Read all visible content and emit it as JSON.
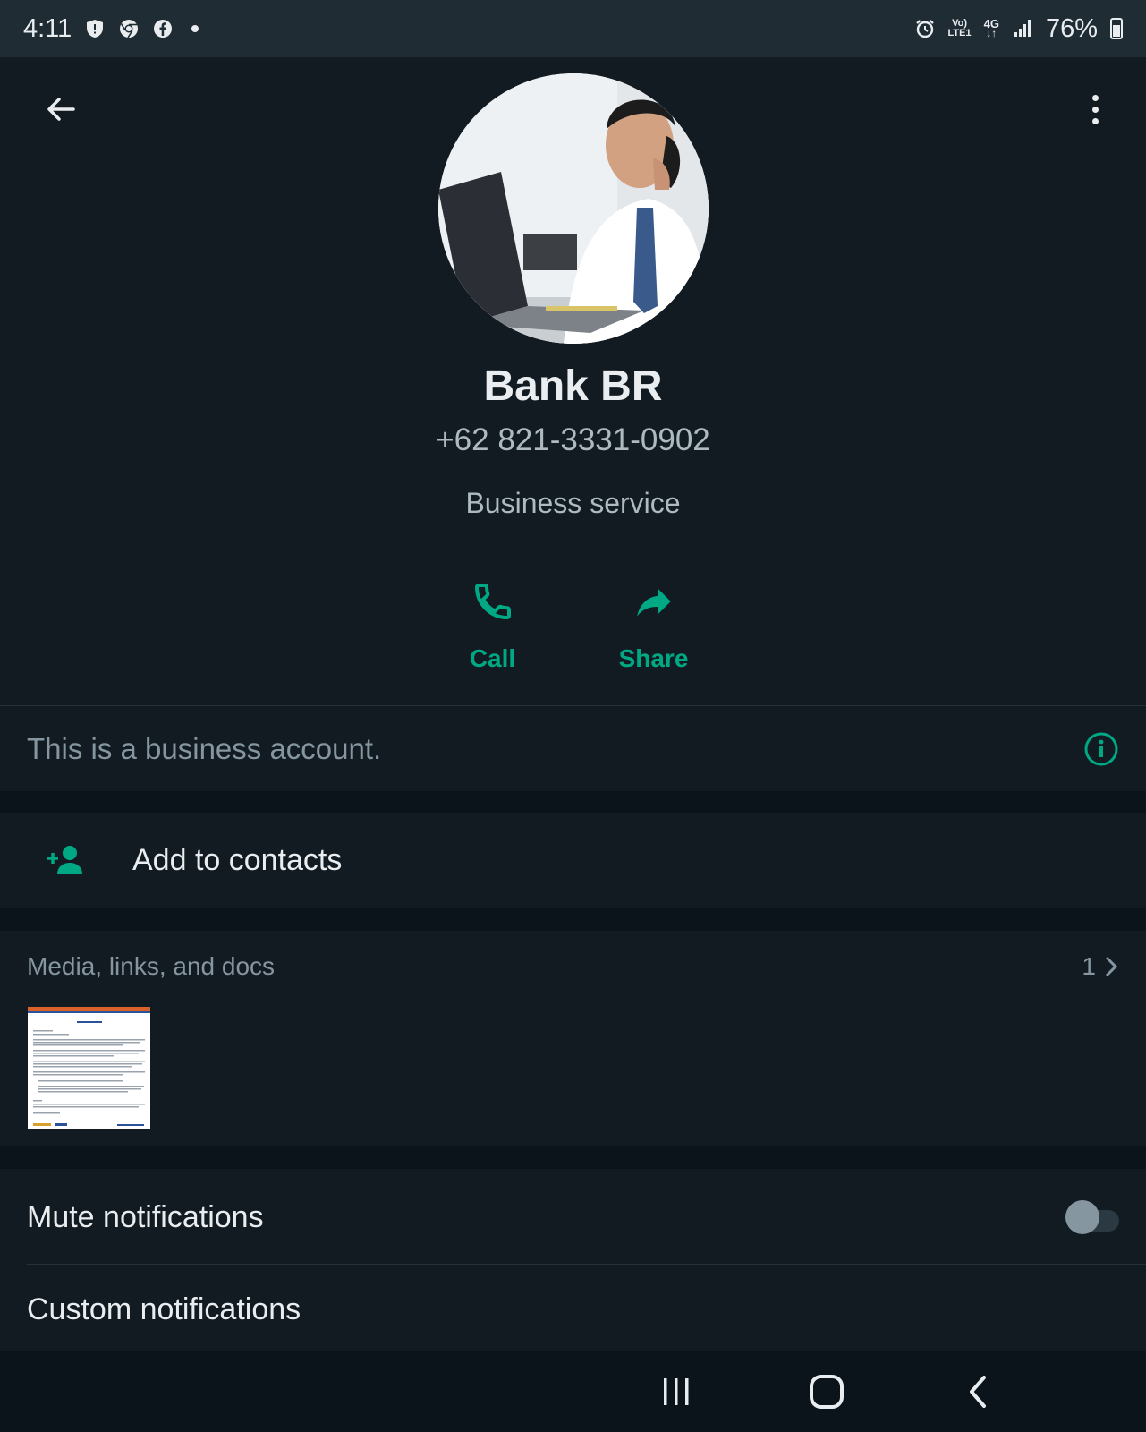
{
  "status_bar": {
    "time": "4:11",
    "battery": "76%",
    "net_top": "Vo)",
    "net_bottom": "LTE1",
    "net_gen": "4G",
    "icons": [
      "shield-icon",
      "chrome-icon",
      "facebook-icon",
      "notification-dot",
      "alarm-icon",
      "volte-icon",
      "4g-icon",
      "signal-icon",
      "battery-icon"
    ]
  },
  "header": {
    "back_icon": "arrow-left-icon",
    "menu_icon": "more-vert-icon"
  },
  "profile": {
    "name": "Bank BR",
    "phone": "+62 821-3331-0902",
    "category": "Business service"
  },
  "actions": [
    {
      "label": "Call",
      "icon": "phone-icon"
    },
    {
      "label": "Share",
      "icon": "share-icon"
    }
  ],
  "business_notice": {
    "text": "This is a business account.",
    "icon": "info-icon"
  },
  "add_contact": {
    "label": "Add to contacts",
    "icon": "person-add-icon"
  },
  "media": {
    "title": "Media, links, and docs",
    "count": "1"
  },
  "notifications": {
    "mute_label": "Mute notifications",
    "mute_on": false,
    "custom_label": "Custom notifications"
  },
  "colors": {
    "accent": "#00a884",
    "background": "#121b22",
    "divider": "#0b141a"
  }
}
